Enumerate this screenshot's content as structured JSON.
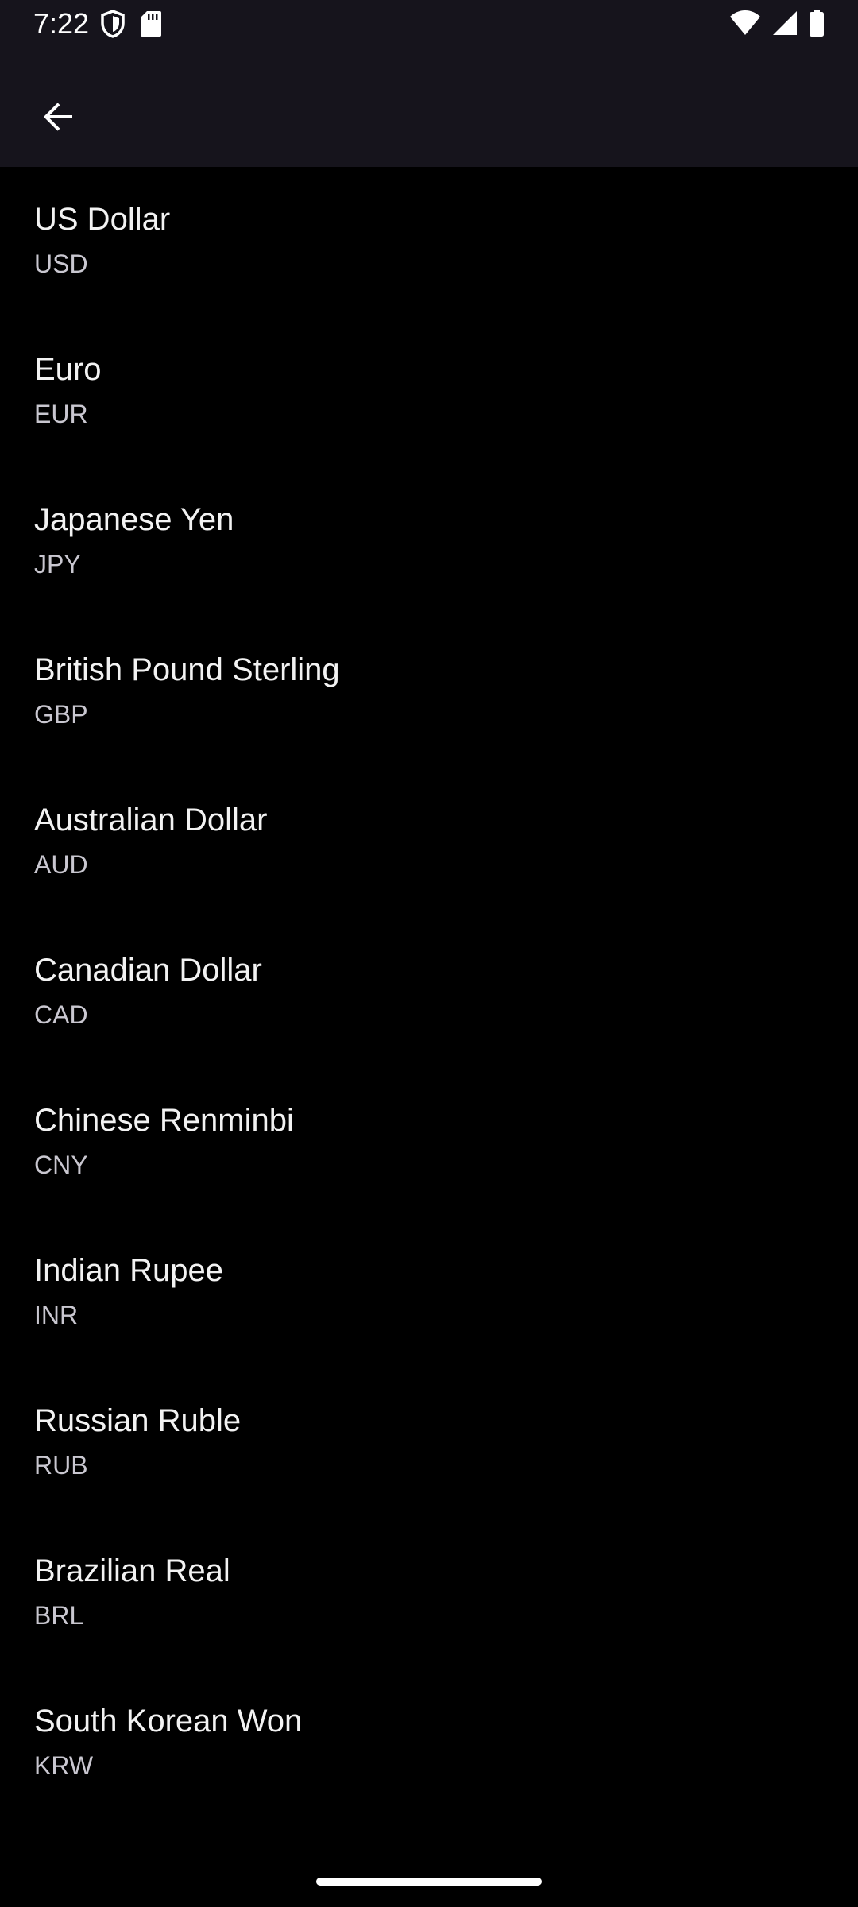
{
  "status_bar": {
    "time": "7:22",
    "left_icons": [
      "shield-icon",
      "sd-card-icon"
    ],
    "right_icons": [
      "wifi-icon",
      "cell-signal-icon",
      "battery-icon"
    ]
  },
  "app_bar": {
    "back_icon": "arrow-back-icon"
  },
  "currencies": [
    {
      "name": "US Dollar",
      "code": "USD"
    },
    {
      "name": "Euro",
      "code": "EUR"
    },
    {
      "name": "Japanese Yen",
      "code": "JPY"
    },
    {
      "name": "British Pound Sterling",
      "code": "GBP"
    },
    {
      "name": "Australian Dollar",
      "code": "AUD"
    },
    {
      "name": "Canadian Dollar",
      "code": "CAD"
    },
    {
      "name": "Chinese Renminbi",
      "code": "CNY"
    },
    {
      "name": "Indian Rupee",
      "code": "INR"
    },
    {
      "name": "Russian Ruble",
      "code": "RUB"
    },
    {
      "name": "Brazilian Real",
      "code": "BRL"
    },
    {
      "name": "South Korean Won",
      "code": "KRW"
    }
  ],
  "colors": {
    "background": "#000000",
    "app_bar": "#16141c",
    "primary_text": "#f2f2f2",
    "secondary_text": "#c9c7d0"
  }
}
